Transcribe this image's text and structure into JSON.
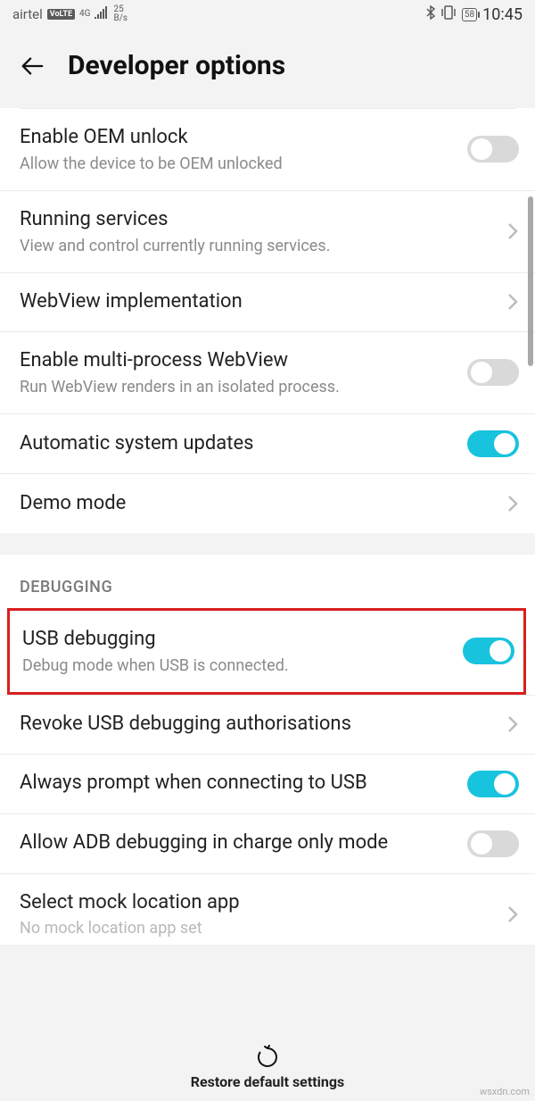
{
  "status": {
    "carrier": "airtel",
    "volte": "VoLTE",
    "net_top": "4G",
    "net_bot": "4G",
    "rate_top": "25",
    "rate_bot": "B/s",
    "battery": "58",
    "time": "10:45"
  },
  "header": {
    "title": "Developer options"
  },
  "items": {
    "oem": {
      "title": "Enable OEM unlock",
      "sub": "Allow the device to be OEM unlocked"
    },
    "running": {
      "title": "Running services",
      "sub": "View and control currently running services."
    },
    "webview": {
      "title": "WebView implementation"
    },
    "multiprocess": {
      "title": "Enable multi-process WebView",
      "sub": "Run WebView renders in an isolated process."
    },
    "autoupdate": {
      "title": "Automatic system updates"
    },
    "demo": {
      "title": "Demo mode"
    },
    "usb_debug": {
      "title": "USB debugging",
      "sub": "Debug mode when USB is connected."
    },
    "revoke": {
      "title": "Revoke USB debugging authorisations"
    },
    "always_prompt": {
      "title": "Always prompt when connecting to USB"
    },
    "adb_charge": {
      "title": "Allow ADB debugging in charge only mode"
    },
    "mock": {
      "title": "Select mock location app",
      "sub": "No mock location app set"
    }
  },
  "section": {
    "debugging": "DEBUGGING"
  },
  "bottom": {
    "restore": "Restore default settings"
  },
  "watermark": "wsxdn.com"
}
